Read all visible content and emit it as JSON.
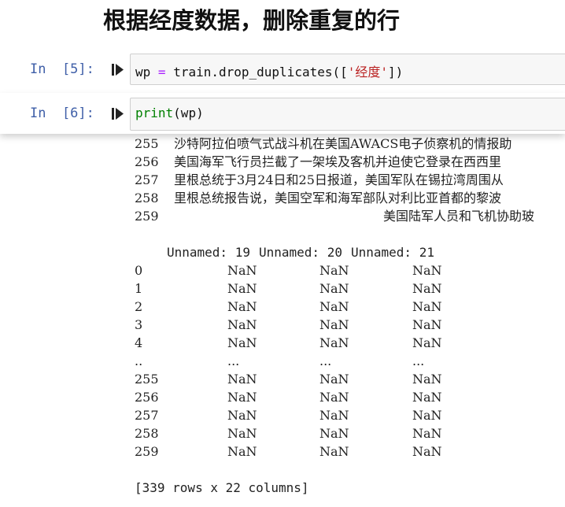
{
  "heading": "根据经度数据，删除重复的行",
  "cells": {
    "cell5": {
      "prompt": "In  [5]:",
      "code_var": "wp",
      "code_eq": "=",
      "code_call": "train.drop_duplicates([",
      "code_str": "'经度'",
      "code_end": "])"
    },
    "cell6": {
      "prompt": "In  [6]:",
      "code_builtin": "print",
      "code_rest": "(wp)"
    }
  },
  "output": {
    "text_rows": [
      {
        "index": "255",
        "text": "沙特阿拉伯喷气式战斗机在美国AWACS电子侦察机的情报助"
      },
      {
        "index": "256",
        "text": "美国海军飞行员拦截了一架埃及客机并迫使它登录在西西里"
      },
      {
        "index": "257",
        "text": "里根总统于3月24日和25日报道，美国军队在锡拉湾周围从"
      },
      {
        "index": "258",
        "text": "里根总统报告说，美国空军和海军部队对利比亚首都的黎波"
      },
      {
        "index": "259",
        "text": "美国陆军人员和飞机协助玻"
      }
    ],
    "columns": [
      "Unnamed: 19",
      "Unnamed: 20",
      "Unnamed: 21"
    ],
    "table_rows": [
      {
        "index": "0",
        "values": [
          "NaN",
          "NaN",
          "NaN"
        ]
      },
      {
        "index": "1",
        "values": [
          "NaN",
          "NaN",
          "NaN"
        ]
      },
      {
        "index": "2",
        "values": [
          "NaN",
          "NaN",
          "NaN"
        ]
      },
      {
        "index": "3",
        "values": [
          "NaN",
          "NaN",
          "NaN"
        ]
      },
      {
        "index": "4",
        "values": [
          "NaN",
          "NaN",
          "NaN"
        ]
      },
      {
        "index": "..",
        "values": [
          "...",
          "...",
          "..."
        ]
      },
      {
        "index": "255",
        "values": [
          "NaN",
          "NaN",
          "NaN"
        ]
      },
      {
        "index": "256",
        "values": [
          "NaN",
          "NaN",
          "NaN"
        ]
      },
      {
        "index": "257",
        "values": [
          "NaN",
          "NaN",
          "NaN"
        ]
      },
      {
        "index": "258",
        "values": [
          "NaN",
          "NaN",
          "NaN"
        ]
      },
      {
        "index": "259",
        "values": [
          "NaN",
          "NaN",
          "NaN"
        ]
      }
    ],
    "summary": "[339 rows x 22 columns]"
  },
  "icons": {
    "run": "run-cell-icon"
  }
}
